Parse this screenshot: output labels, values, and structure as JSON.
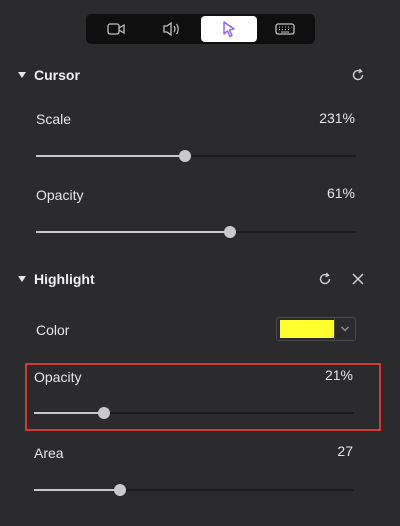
{
  "toolbar": {
    "tabs": [
      {
        "icon": "camera-icon"
      },
      {
        "icon": "speaker-icon"
      },
      {
        "icon": "cursor-icon",
        "active": true
      },
      {
        "icon": "keyboard-icon"
      }
    ]
  },
  "cursor_section": {
    "title": "Cursor",
    "scale": {
      "label": "Scale",
      "value_text": "231%",
      "level": 0.465
    },
    "opacity": {
      "label": "Opacity",
      "value_text": "61%",
      "level": 0.605
    }
  },
  "highlight_section": {
    "title": "Highlight",
    "color": {
      "label": "Color",
      "swatch": "#ffff2e"
    },
    "opacity": {
      "label": "Opacity",
      "value_text": "21%",
      "level": 0.22
    },
    "area": {
      "label": "Area",
      "value_text": "27",
      "level": 0.27
    }
  },
  "colors": {
    "panel_bg": "#2b2b2d",
    "annotation_outline": "#d23a33",
    "accent_cursor": "#8a5cf6"
  }
}
